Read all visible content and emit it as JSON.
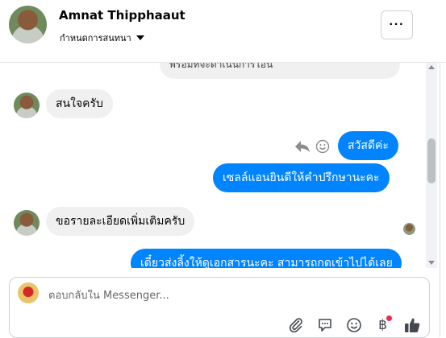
{
  "header": {
    "contact_name": "Amnat Thipphaaut",
    "subtitle": "กำหนดการสนทนา",
    "more_label": "···"
  },
  "messages": {
    "partial_top": "พร้อมที่จะดำเนินการโอน",
    "incoming_1": "สนใจครับ",
    "outgoing_1": "สวัสดีค่ะ",
    "outgoing_2": "เซลล์แอนยินดีให้คำปรึกษานะคะ",
    "incoming_2": "ขอรายละเอียดเพิ่มเติมครับ",
    "outgoing_3": "เดี๋ยวส่งลิ้งให้ดูเอกสารนะคะ สามารถกดเข้าไปได้เลย"
  },
  "composer": {
    "placeholder": "ตอบกลับใน Messenger...",
    "baht_symbol": "฿"
  },
  "icons": {
    "reply": "reply-icon",
    "react": "smiley-icon",
    "attach": "paperclip-icon",
    "saved_replies": "chat-bubble-icon",
    "emoji": "emoji-icon",
    "payment": "baht-icon",
    "like": "thumbs-up-icon"
  },
  "colors": {
    "outgoing_bubble": "#0084ff",
    "incoming_bubble": "#f0f0f0",
    "notification_dot": "#f02849"
  }
}
